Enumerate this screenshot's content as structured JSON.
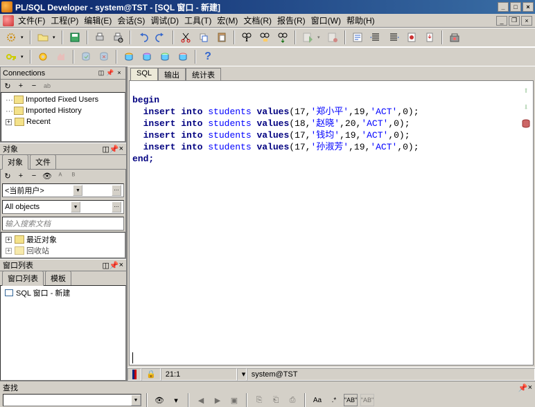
{
  "title": "PL/SQL Developer - system@TST - [SQL 窗口 - 新建]",
  "menu": {
    "file": "文件(F)",
    "project": "工程(P)",
    "edit": "编辑(E)",
    "session": "会话(S)",
    "debug": "调试(D)",
    "tools": "工具(T)",
    "macro": "宏(M)",
    "docs": "文档(R)",
    "report": "报告(R)",
    "window": "窗口(W)",
    "help": "帮助(H)"
  },
  "panels": {
    "connections": {
      "title": "Connections",
      "items": [
        "Imported Fixed Users",
        "Imported History",
        "Recent"
      ]
    },
    "objects": {
      "title": "对象",
      "tab_obj": "对象",
      "tab_file": "文件",
      "current_user": "<当前用户>",
      "all_objects": "All objects",
      "search_placeholder": "输入搜索文档",
      "recent_objects": "最近对象",
      "recycle": "回收站"
    },
    "winlist": {
      "title": "窗口列表",
      "tab1": "窗口列表",
      "tab2": "模板",
      "item": "SQL 窗口 - 新建"
    }
  },
  "sql_tabs": {
    "sql": "SQL",
    "output": "输出",
    "stats": "统计表"
  },
  "editor": {
    "l1": "begin",
    "l2a": "  insert ",
    "l2b": "into ",
    "l2c": "students ",
    "l2d": "values",
    "l2e": "(17,",
    "l2f": "'郑小平'",
    "l2g": ",19,",
    "l2h": "'ACT'",
    "l2i": ",0);",
    "l3a": "  insert ",
    "l3b": "into ",
    "l3c": "students ",
    "l3d": "values",
    "l3e": "(18,",
    "l3f": "'赵晓'",
    "l3g": ",20,",
    "l3h": "'ACT'",
    "l3i": ",0);",
    "l4a": "  insert ",
    "l4b": "into ",
    "l4c": "students ",
    "l4d": "values",
    "l4e": "(17,",
    "l4f": "'钱均'",
    "l4g": ",19,",
    "l4h": "'ACT'",
    "l4i": ",0);",
    "l5a": "  insert ",
    "l5b": "into ",
    "l5c": "students ",
    "l5d": "values",
    "l5e": "(17,",
    "l5f": "'孙淑芳'",
    "l5g": ",19,",
    "l5h": "'ACT'",
    "l5i": ",0);",
    "l6": "end;"
  },
  "status": {
    "pos": "21:1",
    "conn": "system@TST"
  },
  "search": {
    "label": "查找"
  }
}
